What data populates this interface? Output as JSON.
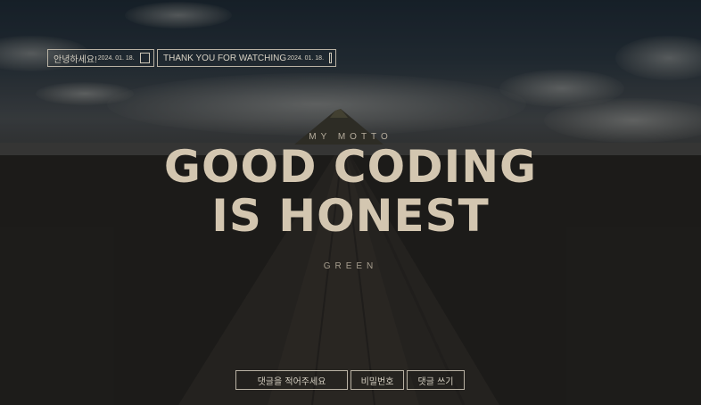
{
  "notices": [
    {
      "title": "안녕하세요!",
      "date": "2024. 01. 18."
    },
    {
      "title": "THANK YOU FOR WATCHING",
      "date": "2024. 01. 18."
    }
  ],
  "hero": {
    "kicker": "MY MOTTO",
    "headline_line1": "GOOD CODING",
    "headline_line2": "IS HONEST",
    "subtitle": "GREEN"
  },
  "comment_form": {
    "comment_placeholder": "댓글을 적어주세요",
    "password_placeholder": "비밀번호",
    "submit_label": "댓글 쓰기"
  },
  "colors": {
    "accent_text": "#d3c6b0",
    "border": "#b9b2a4"
  }
}
